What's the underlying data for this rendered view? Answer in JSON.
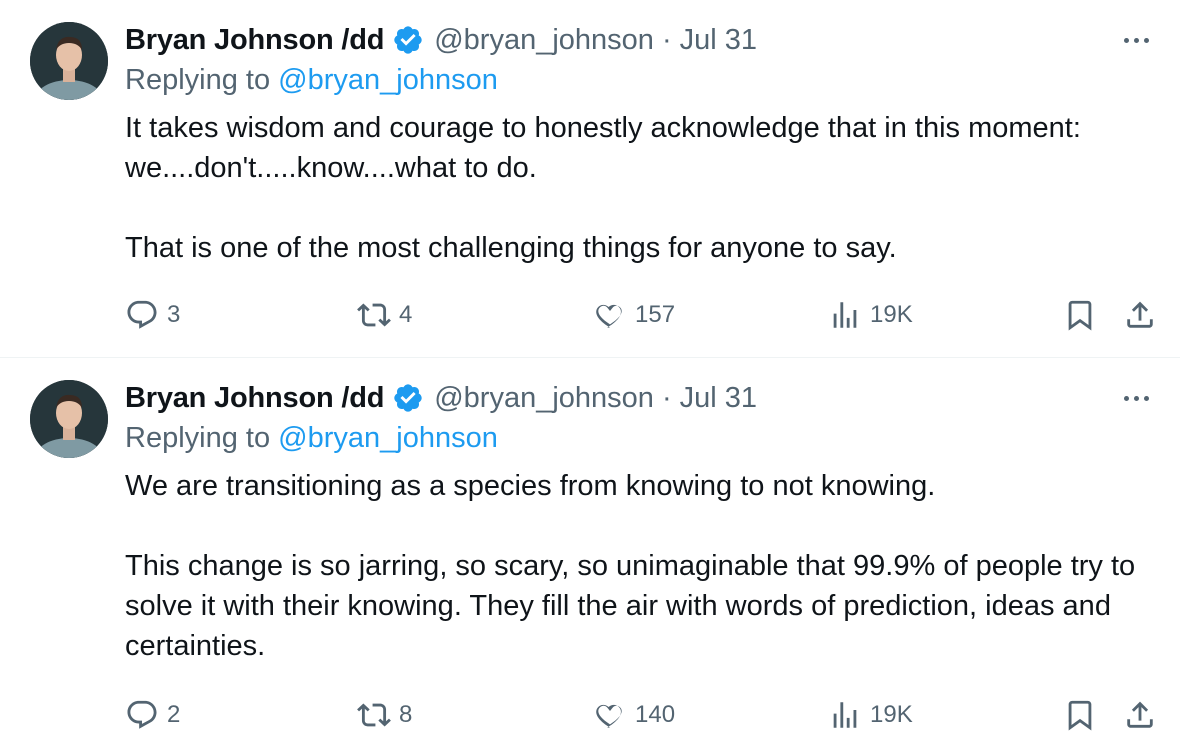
{
  "tweets": [
    {
      "author": {
        "name": "Bryan Johnson /dd",
        "handle": "@bryan_johnson",
        "date": "Jul 31",
        "separator": "·"
      },
      "replying_prefix": "Replying to ",
      "replying_to": "@bryan_johnson",
      "text": "It takes wisdom and courage to honestly acknowledge that in this moment: we....don't.....know....what to do.\n\nThat is one of the most challenging things for anyone to say.",
      "stats": {
        "replies": "3",
        "retweets": "4",
        "likes": "157",
        "views": "19K"
      }
    },
    {
      "author": {
        "name": "Bryan Johnson /dd",
        "handle": "@bryan_johnson",
        "date": "Jul 31",
        "separator": "·"
      },
      "replying_prefix": "Replying to ",
      "replying_to": "@bryan_johnson",
      "text": "We are transitioning as a species from knowing to not knowing.\n\nThis change is so jarring, so scary, so unimaginable that 99.9% of people try to solve it with their knowing. They fill the air with words of prediction, ideas and certainties.",
      "stats": {
        "replies": "2",
        "retweets": "8",
        "likes": "140",
        "views": "19K"
      }
    }
  ],
  "colors": {
    "accent": "#1d9bf0",
    "secondary_text": "#536471",
    "divider": "#eff3f4"
  },
  "icons": [
    "verified-badge-icon",
    "more-icon",
    "reply-icon",
    "retweet-icon",
    "like-icon",
    "views-icon",
    "bookmark-icon",
    "share-icon"
  ]
}
